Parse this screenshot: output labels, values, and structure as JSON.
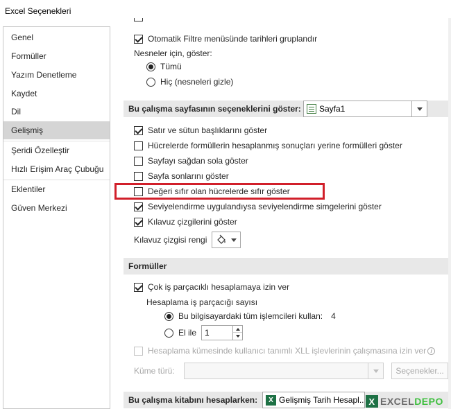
{
  "window": {
    "title": "Excel Seçenekleri"
  },
  "sidebar": {
    "items": [
      {
        "label": "Genel",
        "selected": false
      },
      {
        "label": "Formüller",
        "selected": false
      },
      {
        "label": "Yazım Denetleme",
        "selected": false
      },
      {
        "label": "Kaydet",
        "selected": false
      },
      {
        "label": "Dil",
        "selected": false
      },
      {
        "label": "Gelişmiş",
        "selected": true
      },
      {
        "label": "Şeridi Özelleştir",
        "selected": false
      },
      {
        "label": "Hızlı Erişim Araç Çubuğu",
        "selected": false
      },
      {
        "label": "Eklentiler",
        "selected": false
      },
      {
        "label": "Güven Merkezi",
        "selected": false
      }
    ]
  },
  "workbook_options": {
    "auto_filter_group_dates": {
      "label": "Otomatik Filtre menüsünde tarihleri gruplandır",
      "checked": true
    },
    "objects_label": "Nesneler için, göster:",
    "objects_all": {
      "label": "Tümü",
      "checked": true
    },
    "objects_none": {
      "label": "Hiç (nesneleri gizle)",
      "checked": false
    }
  },
  "sheet_options": {
    "header": "Bu çalışma sayfasının seçeneklerini göster:",
    "sheet_select": "Sayfa1",
    "show_row_col_headers": {
      "label": "Satır ve sütun başlıklarını göster",
      "checked": true
    },
    "show_formulas": {
      "label": "Hücrelerde formüllerin hesaplanmış sonuçları yerine formülleri göster",
      "checked": false
    },
    "right_to_left": {
      "label": "Sayfayı sağdan sola göster",
      "checked": false
    },
    "show_page_breaks": {
      "label": "Sayfa sonlarını göster",
      "checked": false
    },
    "show_zero": {
      "label": "Değeri sıfır olan hücrelerde sıfır göster",
      "checked": false
    },
    "show_outline_symbols": {
      "label": "Seviyelendirme uygulandıysa seviyelendirme simgelerini göster",
      "checked": true
    },
    "show_gridlines": {
      "label": "Kılavuz çizgilerini göster",
      "checked": true
    },
    "gridline_color_label": "Kılavuz çizgisi rengi"
  },
  "formulas": {
    "header": "Formüller",
    "multithreaded": {
      "label": "Çok iş parçacıklı hesaplamaya izin ver",
      "checked": true
    },
    "threads_label": "Hesaplama iş parçacığı sayısı",
    "use_all_processors": {
      "label": "Bu bilgisayardaki tüm işlemcileri kullan:",
      "value": "4",
      "checked": true
    },
    "manual": {
      "label": "El ile",
      "checked": false,
      "value": "1"
    },
    "xll_cluster": {
      "label": "Hesaplama kümesinde kullanıcı tanımlı XLL işlevlerinin çalışmasına izin ver",
      "checked": false
    },
    "cluster_type_label": "Küme türü:",
    "cluster_options_button": "Seçenekler..."
  },
  "workbook_calc": {
    "header": "Bu çalışma kitabını hesaplarken:",
    "workbook_select": "Gelişmiş Tarih Hesapl..."
  },
  "watermark": {
    "x": "X",
    "part_a": "EXCEL",
    "part_b": "DEPO"
  },
  "colors": {
    "highlight": "#d11f2a",
    "selected_bg": "#d5d5d5",
    "section_bg": "#e8e8e8",
    "excel_green": "#1e7145"
  }
}
